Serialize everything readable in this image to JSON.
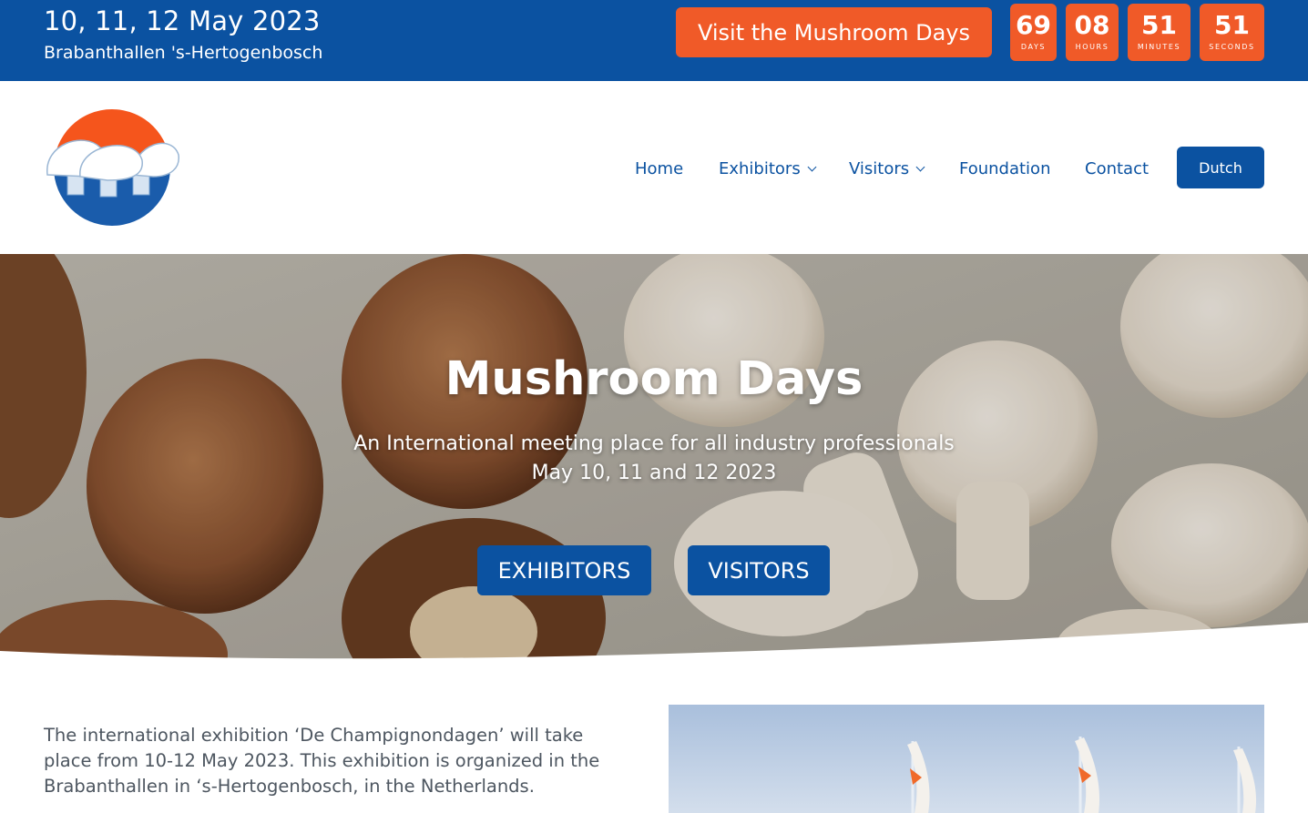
{
  "topbar": {
    "date": "10, 11, 12 May 2023",
    "venue": "Brabanthallen 's-Hertogenbosch",
    "visit_label": "Visit the Mushroom Days",
    "countdown": [
      {
        "value": "69",
        "label": "DAYS"
      },
      {
        "value": "08",
        "label": "HOURS"
      },
      {
        "value": "51",
        "label": "MINUTES"
      },
      {
        "value": "51",
        "label": "SECONDS"
      }
    ]
  },
  "nav": {
    "items": [
      {
        "label": "Home",
        "has_dropdown": false
      },
      {
        "label": "Exhibitors",
        "has_dropdown": true
      },
      {
        "label": "Visitors",
        "has_dropdown": true
      },
      {
        "label": "Foundation",
        "has_dropdown": false
      },
      {
        "label": "Contact",
        "has_dropdown": false
      }
    ],
    "language_label": "Dutch"
  },
  "hero": {
    "title": "Mushroom Days",
    "subtitle_line1": "An International meeting place for all industry professionals",
    "subtitle_line2": "May 10, 11 and 12 2023",
    "exhibitors_label": "EXHIBITORS",
    "visitors_label": "VISITORS"
  },
  "intro": {
    "text": "The international exhibition ‘De Champignondagen’ will take place from 10-12 May 2023. This exhibition is organized in the Brabanthallen in ‘s-Hertogenbosch, in the Netherlands."
  },
  "colors": {
    "brand_blue": "#0b52a1",
    "accent_orange": "#f05a28"
  },
  "icons": {
    "logo": "mushroom-logo-icon",
    "dropdown": "chevron-down-icon"
  }
}
